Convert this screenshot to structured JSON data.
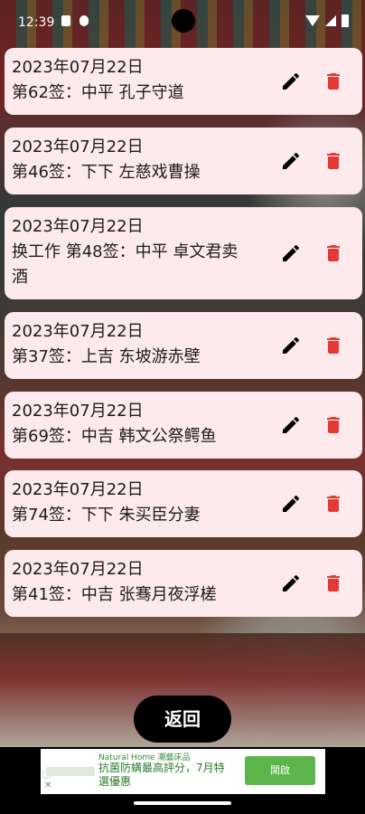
{
  "status_bar": {
    "time": "12:39"
  },
  "entries": [
    {
      "lines": [
        "2023年07月22日",
        "第62签：中平 孔子守道"
      ]
    },
    {
      "lines": [
        "2023年07月22日",
        "第46签：下下 左慈戏曹操"
      ]
    },
    {
      "lines": [
        "2023年07月22日",
        "换工作 第48签：中平 卓文君卖",
        "酒"
      ]
    },
    {
      "lines": [
        "2023年07月22日",
        "第37签：上吉 东坡游赤壁"
      ]
    },
    {
      "lines": [
        "2023年07月22日",
        "第69签：中吉 韩文公祭鳄鱼"
      ]
    },
    {
      "lines": [
        "2023年07月22日",
        "第74签：下下 朱买臣分妻"
      ]
    },
    {
      "lines": [
        "2023年07月22日",
        "第41签：中吉 张骞月夜浮槎"
      ]
    }
  ],
  "icons": {
    "edit": "pencil-icon",
    "delete": "trash-icon"
  },
  "colors": {
    "card_bg": "#fdeaec",
    "delete_red": "#e53935",
    "button_bg": "#000000"
  },
  "back_button": {
    "label": "返回"
  },
  "ad": {
    "brand": "Natural Home 潮藝床品",
    "text": "抗菌防螨最高評分，7月特選優惠",
    "cta": "開啟",
    "info": "ⓘ",
    "close": "✕"
  }
}
